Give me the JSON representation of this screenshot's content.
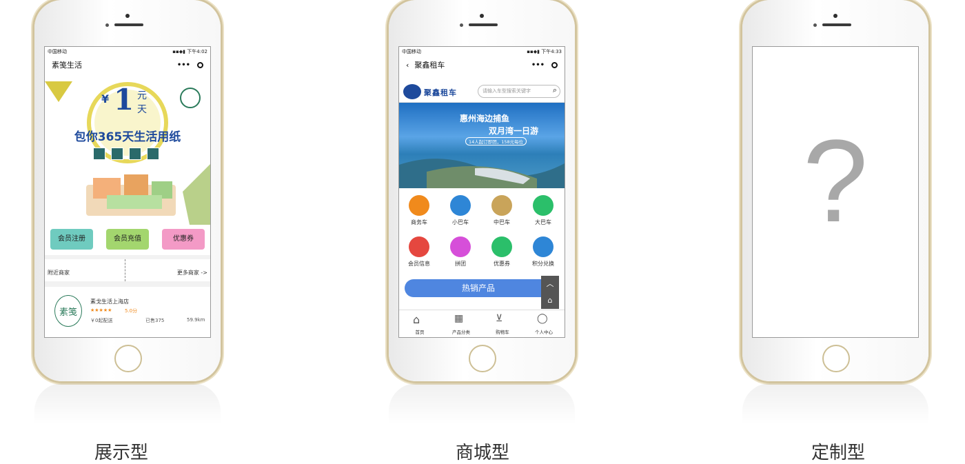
{
  "captions": [
    "展示型",
    "商城型",
    "定制型"
  ],
  "phone1": {
    "status_carrier": "中国移动",
    "status_time": "下午4:02",
    "title": "素笺生活",
    "banner": {
      "price": "1",
      "unit_top": "元",
      "unit_bottom": "天",
      "currency": "¥",
      "headline": "包你365天生活用纸"
    },
    "buttons": [
      "会员注册",
      "会员充值",
      "优惠券"
    ],
    "nearby_label": "附近商家",
    "more_label": "更多商家 ->",
    "store": {
      "name": "素戈生活上海店",
      "stars": "★★★★★",
      "score": "5.0分",
      "min_delivery": "￥0起配送",
      "sold": "已售375",
      "distance": "59.9km",
      "logo_text": "素笺"
    }
  },
  "phone2": {
    "status_carrier": "中国移动",
    "status_time": "下午4:33",
    "title": "聚鑫租车",
    "brand": "聚鑫租车",
    "search_placeholder": "请输入车型搜索关键字",
    "banner_line1": "惠州海边捕鱼",
    "banner_line2": "双月湾一日游",
    "banner_tag": "14人起订即团，158元每位",
    "grid": [
      {
        "label": "商务车",
        "icon": "car-icon",
        "color": "#f08a1c"
      },
      {
        "label": "小巴车",
        "icon": "minibus-icon",
        "color": "#2e86d6"
      },
      {
        "label": "中巴车",
        "icon": "midbus-icon",
        "color": "#c9a45a"
      },
      {
        "label": "大巴车",
        "icon": "bigbus-icon",
        "color": "#2bbf6a"
      },
      {
        "label": "会员信息",
        "icon": "member-card-icon",
        "color": "#e5473f"
      },
      {
        "label": "拼团",
        "icon": "group-buy-icon",
        "color": "#d64fd9"
      },
      {
        "label": "优惠券",
        "icon": "coupon-icon",
        "color": "#2bbf6a"
      },
      {
        "label": "积分兑换",
        "icon": "points-icon",
        "color": "#2e86d6"
      }
    ],
    "hot_label": "热销产品",
    "tabs": [
      "首页",
      "产品分类",
      "购物车",
      "个人中心"
    ]
  },
  "phone3": {
    "placeholder": "?"
  }
}
